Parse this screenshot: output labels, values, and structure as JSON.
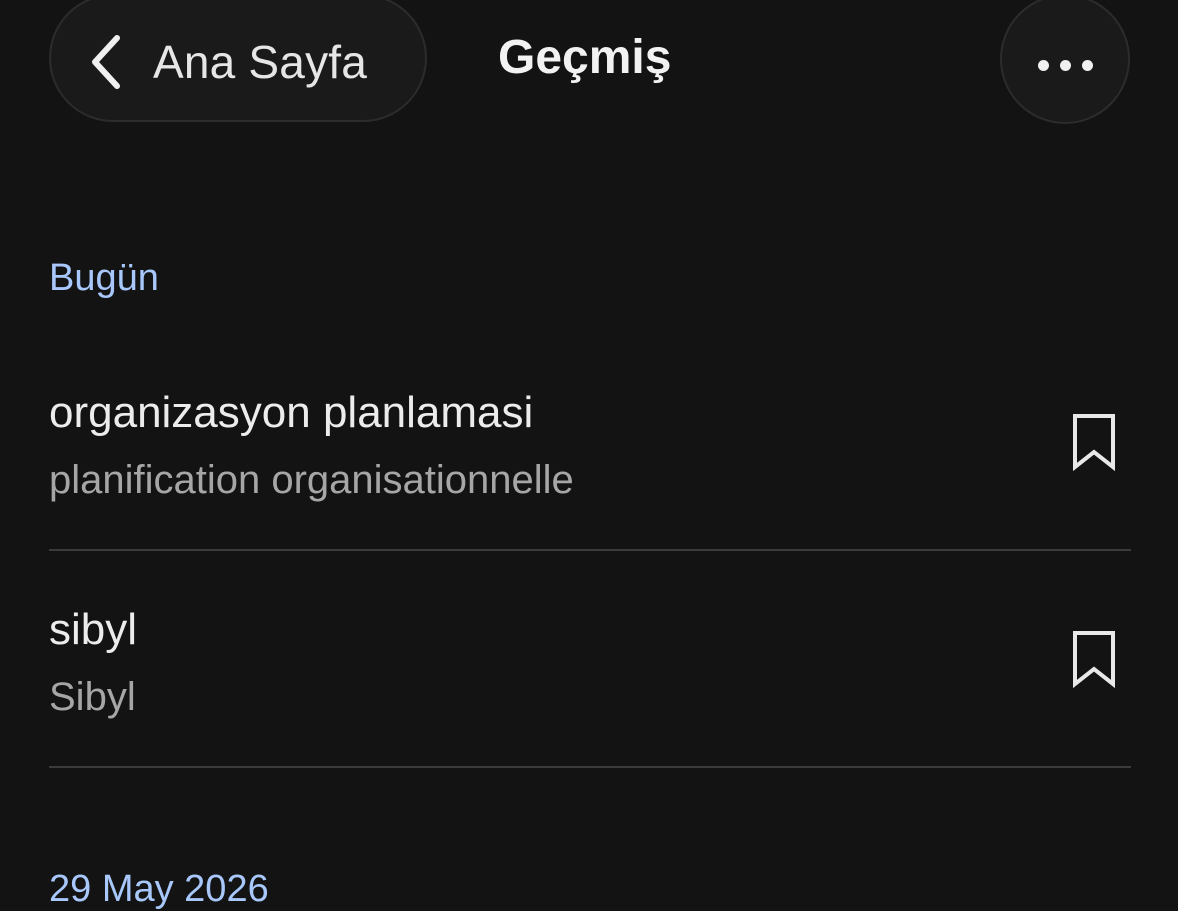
{
  "header": {
    "back_label": "Ana Sayfa",
    "title": "Geçmiş"
  },
  "sections": [
    {
      "label": "Bugün",
      "entries": [
        {
          "source": "organizasyon planlamasi",
          "translation": "planification organisationnelle",
          "bookmarked": false
        },
        {
          "source": "sibyl",
          "translation": "Sibyl",
          "bookmarked": false
        }
      ]
    },
    {
      "label": "29 May 2026",
      "entries": []
    }
  ],
  "icons": {
    "back": "chevron-left-icon",
    "more": "more-horizontal-icon",
    "bookmark": "bookmark-outline-icon"
  },
  "colors": {
    "background": "#131314",
    "section_header": "#a8c7fa",
    "primary_text": "#ececec",
    "secondary_text": "#a6a6a6",
    "divider": "#3b3b3d"
  }
}
